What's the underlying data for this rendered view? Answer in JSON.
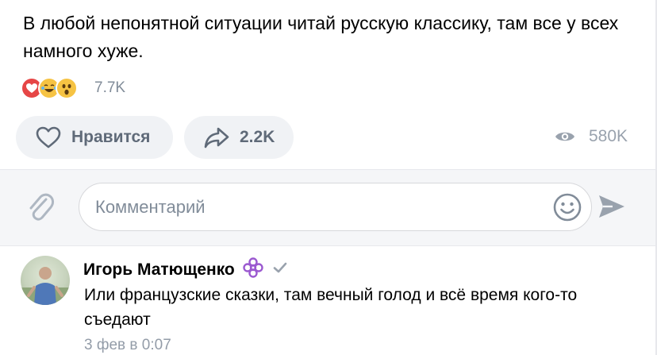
{
  "post": {
    "text": "В любой непонятной ситуации читай русскую классику, там все у всех намного хуже.",
    "reactions": {
      "icons": [
        "heart-reaction",
        "laughing-reaction",
        "wow-reaction"
      ],
      "count": "7.7K"
    }
  },
  "actions": {
    "like_label": "Нравится",
    "share_count": "2.2K",
    "views_count": "580K"
  },
  "comment_box": {
    "placeholder": "Комментарий",
    "value": ""
  },
  "comment": {
    "author": "Игорь Матющенко",
    "text": "Или французские сказки, там вечный голод и всё время кого-то съедают",
    "date": "3 фев в 0:07"
  },
  "colors": {
    "muted_text": "#818c99",
    "button_bg": "#f0f2f5",
    "badge_purple": "#9b59d0"
  }
}
